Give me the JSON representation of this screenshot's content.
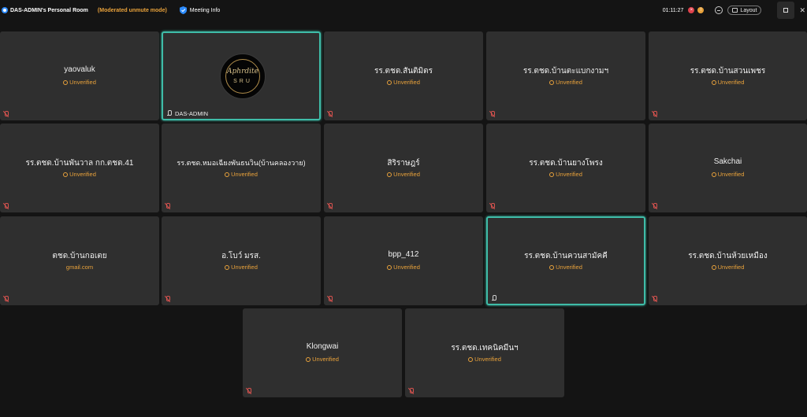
{
  "topbar": {
    "room_title": "DAS-ADMIN's Personal Room",
    "mode": "(Moderated unmute mode)",
    "meeting_info": "Meeting Info",
    "timer": "01:11:27",
    "layout_label": "Layout"
  },
  "host": {
    "label": "DAS-ADMIN",
    "logo_script": "Aphrdite",
    "logo_text": "SRU"
  },
  "tiles": [
    {
      "name": "yaovaluk",
      "status": "Unverified"
    },
    {
      "name": "รร.ตชด.สันติมิตร",
      "status": "Unverified"
    },
    {
      "name": "รร.ตชด.บ้านตะแบกงามฯ",
      "status": "Unverified"
    },
    {
      "name": "รร.ตชด.บ้านสวนเพชร",
      "status": "Unverified"
    },
    {
      "name": "รร.ตชด.บ้านพันวาล กก.ตชด.41",
      "status": "Unverified"
    },
    {
      "name": "รร.ตชด.หมอเฉียงพันธนวิน(บ้านคลองวาย)",
      "status": "Unverified"
    },
    {
      "name": "สิริราษฎร์",
      "status": "Unverified"
    },
    {
      "name": "รร.ตชด.บ้านยางโพรง",
      "status": "Unverified"
    },
    {
      "name": "Sakchai",
      "status": "Unverified"
    },
    {
      "name": "ตชด.บ้านกอเตย",
      "status": "gmail.com"
    },
    {
      "name": "อ.โบว์ มรส.",
      "status": "Unverified"
    },
    {
      "name": "bpp_412",
      "status": "Unverified"
    },
    {
      "name": "รร.ตชด.บ้านควนสามัคคี",
      "status": "Unverified"
    },
    {
      "name": "รร.ตชด.บ้านห้วยเหมือง",
      "status": "Unverified"
    },
    {
      "name": "Klongwai",
      "status": "Unverified"
    },
    {
      "name": "รร.ตชด.เทคนิคมีนฯ",
      "status": "Unverified"
    }
  ]
}
